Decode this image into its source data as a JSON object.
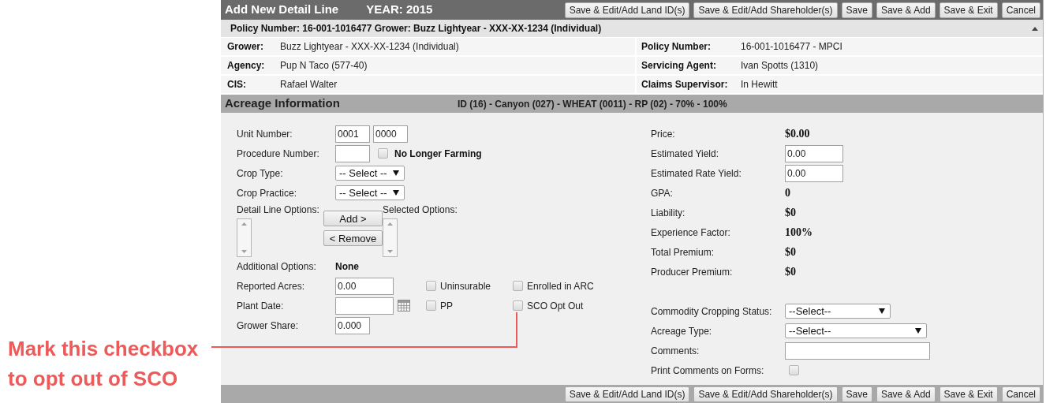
{
  "header": {
    "title": "Add New Detail Line",
    "year": "YEAR: 2015",
    "buttons": [
      "Save & Edit/Add Land ID(s)",
      "Save & Edit/Add Shareholder(s)",
      "Save",
      "Save & Add",
      "Save & Exit",
      "Cancel"
    ]
  },
  "policy_bar": {
    "text": "Policy Number: 16-001-1016477 Grower: Buzz Lightyear - XXX-XX-1234 (Individual)"
  },
  "info_rows": [
    {
      "left": {
        "label": "Grower:",
        "value": "Buzz Lightyear - XXX-XX-1234 (Individual)"
      },
      "right": {
        "label": "Policy Number:",
        "value": "16-001-1016477 - MPCI"
      }
    },
    {
      "left": {
        "label": "Agency:",
        "value": "Pup N Taco (577-40)"
      },
      "right": {
        "label": "Servicing Agent:",
        "value": "Ivan Spotts (1310)"
      }
    },
    {
      "left": {
        "label": "CIS:",
        "value": "Rafael Walter"
      },
      "right": {
        "label": "Claims Supervisor:",
        "value": "In Hewitt"
      }
    }
  ],
  "acreage": {
    "title": "Acreage Information",
    "summary": "ID (16) - Canyon (027) - WHEAT (0011) - RP (02) - 70% - 100%"
  },
  "left_form": {
    "unit_number": {
      "label": "Unit Number:",
      "values": [
        "0001",
        "0000"
      ]
    },
    "procedure_number": {
      "label": "Procedure Number:",
      "no_longer_farming": {
        "label": "No Longer Farming",
        "checked": false
      }
    },
    "crop_type": {
      "label": "Crop Type:",
      "value": "-- Select --"
    },
    "crop_practice": {
      "label": "Crop Practice:",
      "value": "-- Select --"
    },
    "options": {
      "available_label": "Detail Line Options:",
      "selected_label": "Selected Options:",
      "add_button": "Add >",
      "remove_button": "< Remove"
    },
    "additional_options": {
      "label": "Additional Options:",
      "value": "None"
    },
    "reported_acres": {
      "label": "Reported Acres:",
      "value": "0.00",
      "checkboxes": [
        {
          "label": "Uninsurable",
          "checked": false
        },
        {
          "label": "Enrolled in ARC",
          "checked": false
        }
      ]
    },
    "plant_date": {
      "label": "Plant Date:",
      "checkboxes": [
        {
          "label": "PP",
          "checked": false
        },
        {
          "label": "SCO Opt Out",
          "checked": false
        }
      ]
    },
    "grower_share": {
      "label": "Grower Share:",
      "value": "0.000"
    }
  },
  "right_form": {
    "summary": [
      {
        "kind": "value",
        "label": "Price:",
        "value": "$0.00"
      },
      {
        "kind": "input",
        "label": "Estimated Yield:",
        "value": "0.00"
      },
      {
        "kind": "input",
        "label": "Estimated Rate Yield:",
        "value": "0.00"
      },
      {
        "kind": "value",
        "label": "GPA:",
        "value": "0"
      },
      {
        "kind": "value",
        "label": "Liability:",
        "value": "$0"
      },
      {
        "kind": "value",
        "label": "Experience Factor:",
        "value": "100%"
      },
      {
        "kind": "value",
        "label": "Total Premium:",
        "value": "$0"
      },
      {
        "kind": "value",
        "label": "Producer Premium:",
        "value": "$0"
      }
    ],
    "extra": [
      {
        "kind": "select",
        "label": "Commodity Cropping Status:",
        "value": "--Select--"
      },
      {
        "kind": "select-wide",
        "label": "Acreage Type:",
        "value": "--Select--"
      },
      {
        "kind": "textbox",
        "label": "Comments:"
      },
      {
        "kind": "checkbox",
        "label": "Print Comments on Forms:",
        "checked": false
      }
    ]
  },
  "footer": {
    "buttons": [
      "Save & Edit/Add Land ID(s)",
      "Save & Edit/Add Shareholder(s)",
      "Save",
      "Save & Add",
      "Save & Exit",
      "Cancel"
    ]
  },
  "annotation": {
    "text": "Mark this checkbox to opt out of SCO"
  }
}
